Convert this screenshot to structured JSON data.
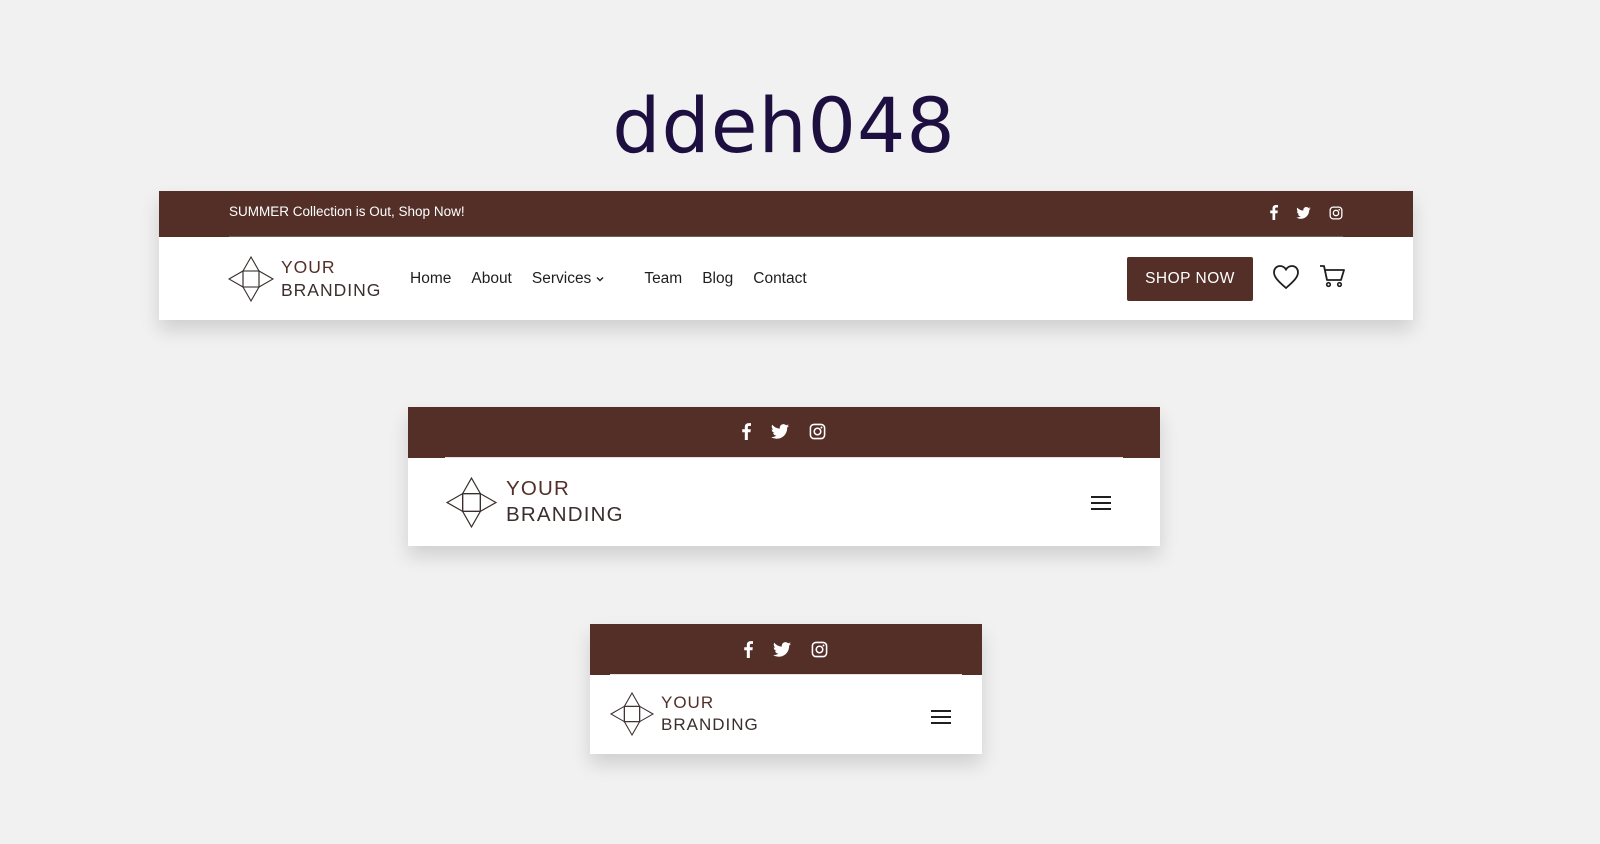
{
  "page": {
    "title": "ddeh048"
  },
  "brand": {
    "line1": "YOUR",
    "line2": "BRANDING"
  },
  "colors": {
    "brand": "#532f28",
    "background": "#f1f1f1",
    "title": "#1d0f3f"
  },
  "desktop": {
    "promo": "SUMMER Collection is Out, Shop Now!",
    "social": [
      "facebook-icon",
      "twitter-icon",
      "instagram-icon"
    ],
    "nav": [
      {
        "label": "Home"
      },
      {
        "label": "About"
      },
      {
        "label": "Services",
        "has_dropdown": true,
        "caret": "⌄"
      },
      {
        "label": "Team"
      },
      {
        "label": "Blog"
      },
      {
        "label": "Contact"
      }
    ],
    "shop_button": "SHOP NOW",
    "icons": [
      "heart-icon",
      "cart-icon"
    ]
  },
  "tablet": {
    "social": [
      "facebook-icon",
      "twitter-icon",
      "instagram-icon"
    ],
    "menu_icon": "hamburger-icon"
  },
  "mobile": {
    "social": [
      "facebook-icon",
      "twitter-icon",
      "instagram-icon"
    ],
    "menu_icon": "hamburger-icon"
  }
}
